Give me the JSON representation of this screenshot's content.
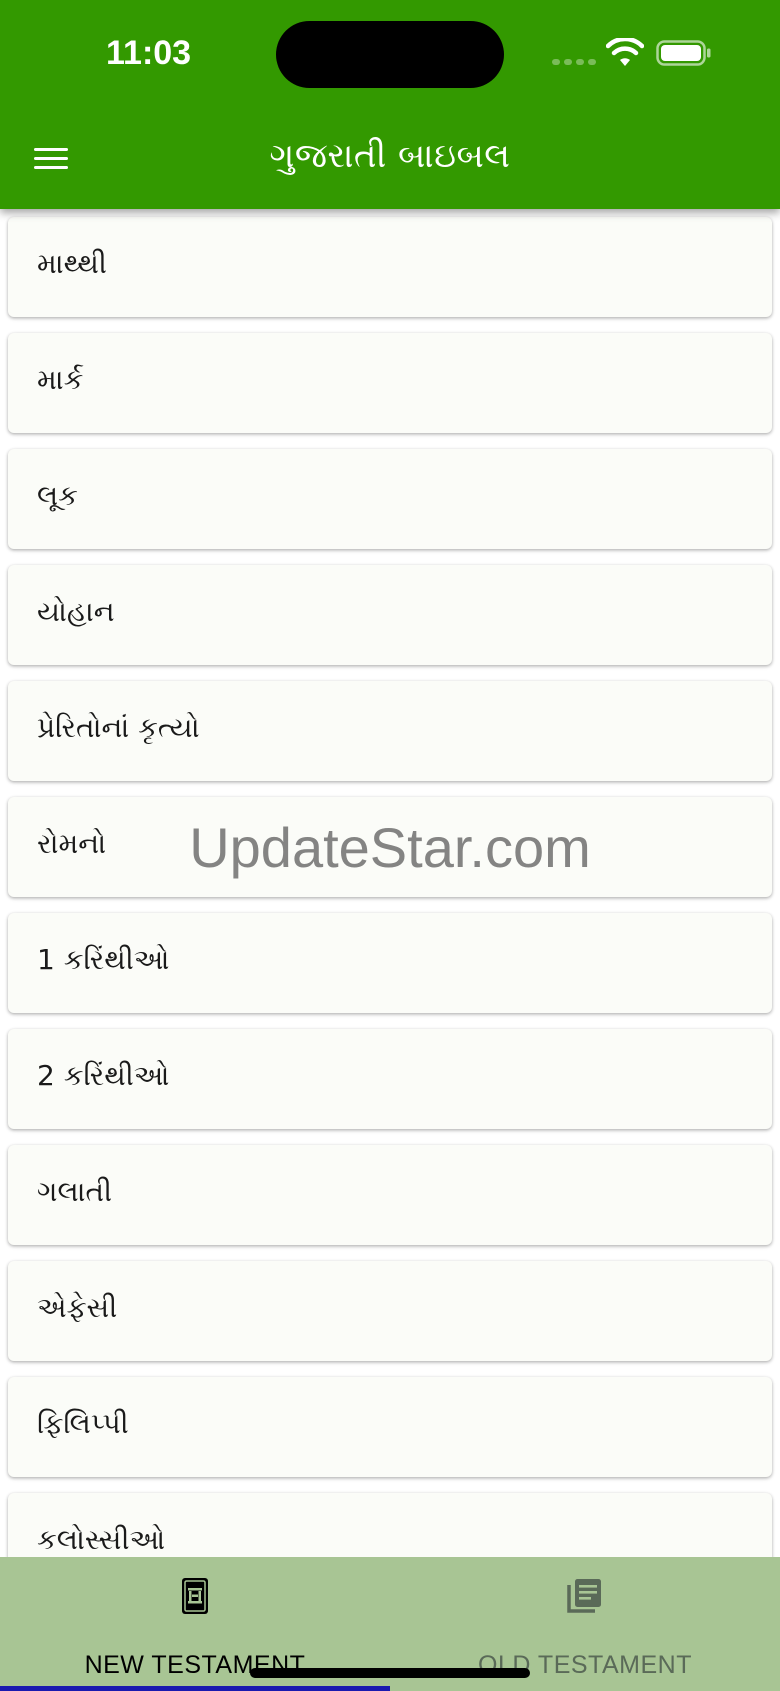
{
  "status_bar": {
    "time": "11:03"
  },
  "app_bar": {
    "title": "ગુજરાતી બાઇબલ",
    "menu_icon": "hamburger-menu-icon"
  },
  "books": [
    "માથ્થી",
    "માર્ક",
    "લૂક",
    "યોહાન",
    "પ્રેરિતોનાં કૃત્યો",
    "રોમનો",
    "1 કરિંથીઓ",
    "2 કરિંથીઓ",
    "ગલાતી",
    "એફેસી",
    "ફિલિપ્પી",
    "કલોસ્સીઓ"
  ],
  "watermark": "UpdateStar.com",
  "tabs": [
    {
      "label": "NEW TESTAMENT",
      "icon": "bible-book-icon",
      "active": true
    },
    {
      "label": "OLD TESTAMENT",
      "icon": "library-books-icon",
      "active": false
    }
  ],
  "colors": {
    "header": "#339900",
    "tabbar": "#a8c594",
    "active_tab": "#000000",
    "inactive_tab": "#5a6a58",
    "indicator": "#1a1ab0"
  }
}
